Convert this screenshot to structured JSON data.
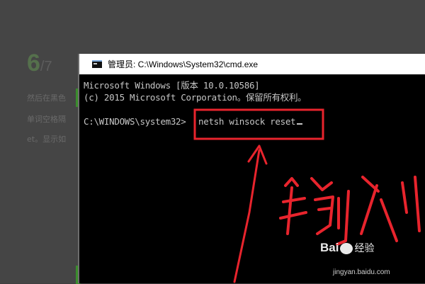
{
  "background": {
    "step_current": "6",
    "step_total": "/7",
    "lines": [
      "然后在黑色",
      "单词空格隔",
      "et。显示如"
    ]
  },
  "cmd_window": {
    "title": "管理员: C:\\Windows\\System32\\cmd.exe",
    "icon": "cmd-icon",
    "lines": [
      "Microsoft Windows [版本 10.0.10586]",
      "(c) 2015 Microsoft Corporation。保留所有权利。"
    ],
    "prompt": "C:\\WINDOWS\\system32>",
    "command": "netsh winsock reset"
  },
  "annotation": {
    "handwritten_text": "输入",
    "color": "#e8242d",
    "arrow": "up-arrow-icon"
  },
  "watermark": {
    "brand": "Bai",
    "brand_suffix": "经验",
    "url": "jingyan.baidu.com"
  }
}
